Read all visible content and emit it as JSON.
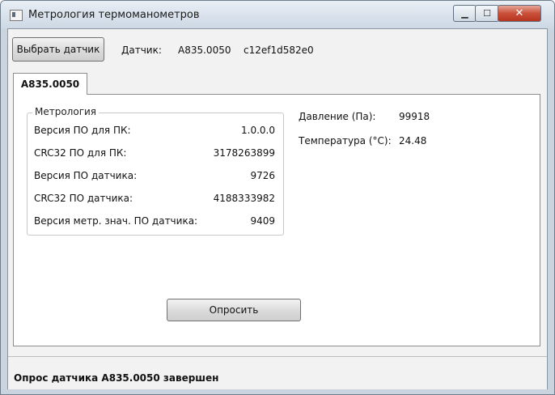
{
  "window": {
    "title": "Метрология термоманометров",
    "minimize_glyph": "▁",
    "maximize_glyph": "☐",
    "close_glyph": "✕"
  },
  "toolbar": {
    "select_button_label": "Выбрать датчик",
    "sensor_label": "Датчик:",
    "sensor_name": "A835.0050",
    "sensor_id": "c12ef1d582e0"
  },
  "tabs": [
    {
      "label": "A835.0050"
    }
  ],
  "metrology": {
    "title": "Метрология",
    "rows": [
      {
        "label": "Версия ПО для ПК:",
        "value": "1.0.0.0"
      },
      {
        "label": "CRC32 ПО для ПК:",
        "value": "3178263899"
      },
      {
        "label": "Версия ПО датчика:",
        "value": "9726"
      },
      {
        "label": "CRC32 ПО датчика:",
        "value": "4188333982"
      },
      {
        "label": "Версия метр. знач. ПО датчика:",
        "value": "9409"
      }
    ]
  },
  "readings": {
    "pressure_label": "Давление (Па):",
    "pressure_value": "99918",
    "temperature_label": "Температура (°С):",
    "temperature_value": "24.48"
  },
  "actions": {
    "query_button_label": "Опросить"
  },
  "status": {
    "text": "Опрос датчика A835.0050 завершен"
  }
}
